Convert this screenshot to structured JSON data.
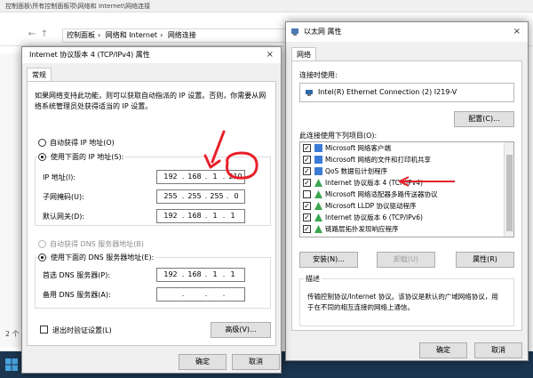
{
  "explorer": {
    "title": "控制面板\\所有控制面板项\\网络和 Internet\\网络连接",
    "breadcrumbs": [
      "控制面板",
      "网络和 Internet",
      "网络连接"
    ],
    "status": "2 个"
  },
  "ipv4_dialog": {
    "title": "Internet 协议版本 4 (TCP/IPv4) 属性",
    "close": "×",
    "tab_general": "常规",
    "intro": [
      "如果网络支持此功能，则可以获取自动指派的 IP 设置。否则，你需要从网",
      "络系统管理员处获得适当的 IP 设置。"
    ],
    "auto_ip": "自动获得 IP 地址(O)",
    "manual_ip": "使用下面的 IP 地址(S):",
    "ip_label": "IP 地址(I):",
    "ip_value": [
      "192",
      "168",
      "1",
      "210"
    ],
    "mask_label": "子网掩码(U):",
    "mask_value": [
      "255",
      "255",
      "255",
      "0"
    ],
    "gateway_label": "默认网关(D):",
    "gateway_value": [
      "192",
      "168",
      "1",
      "1"
    ],
    "auto_dns": "自动获得 DNS 服务器地址(B)",
    "manual_dns": "使用下面的 DNS 服务器地址(E):",
    "pref_dns_label": "首选 DNS 服务器(P):",
    "pref_dns_value": [
      "192",
      "168",
      "1",
      "1"
    ],
    "alt_dns_label": "备用 DNS 服务器(A):",
    "alt_dns_value": [
      "",
      "",
      "",
      ""
    ],
    "dot": ".",
    "validate": "退出时验证设置(L)",
    "advanced": "高级(V)...",
    "ok": "确定",
    "cancel": "取消"
  },
  "eth_dialog": {
    "title": "以太网 属性",
    "close": "×",
    "tab_network": "网络",
    "connect_using_label": "连接时使用:",
    "adapter": "Intel(R) Ethernet Connection (2) I219-V",
    "configure": "配置(C)...",
    "items_label": "此连接使用下列项目(O):",
    "items": [
      {
        "checked": true,
        "label": "Microsoft 网络客户端",
        "icon": "network-client-icon"
      },
      {
        "checked": true,
        "label": "Microsoft 网络的文件和打印机共享",
        "icon": "file-printer-sharing-icon"
      },
      {
        "checked": true,
        "label": "QoS 数据包计划程序",
        "icon": "qos-icon"
      },
      {
        "checked": true,
        "label": "Internet 协议版本 4 (TCP/IPv4)",
        "icon": "protocol-icon"
      },
      {
        "checked": false,
        "label": "Microsoft 网络适配器多路传送器协议",
        "icon": "protocol-icon"
      },
      {
        "checked": true,
        "label": "Microsoft LLDP 协议驱动程序",
        "icon": "protocol-icon"
      },
      {
        "checked": true,
        "label": "Internet 协议版本 6 (TCP/IPv6)",
        "icon": "protocol-icon"
      },
      {
        "checked": true,
        "label": "链路层拓扑发现响应程序",
        "icon": "protocol-icon"
      }
    ],
    "install": "安装(N)...",
    "uninstall": "卸载(U)",
    "properties": "属性(R)",
    "desc_label": "描述",
    "desc": [
      "传输控制协议/Internet 协议。该协议是默认的广域网络协议，用",
      "于在不同的相互连接的网络上通信。"
    ],
    "ok": "确定",
    "cancel": "取消"
  },
  "colors": {
    "annotation_red": "#e8202a",
    "selection_blue": "#0078d7"
  }
}
